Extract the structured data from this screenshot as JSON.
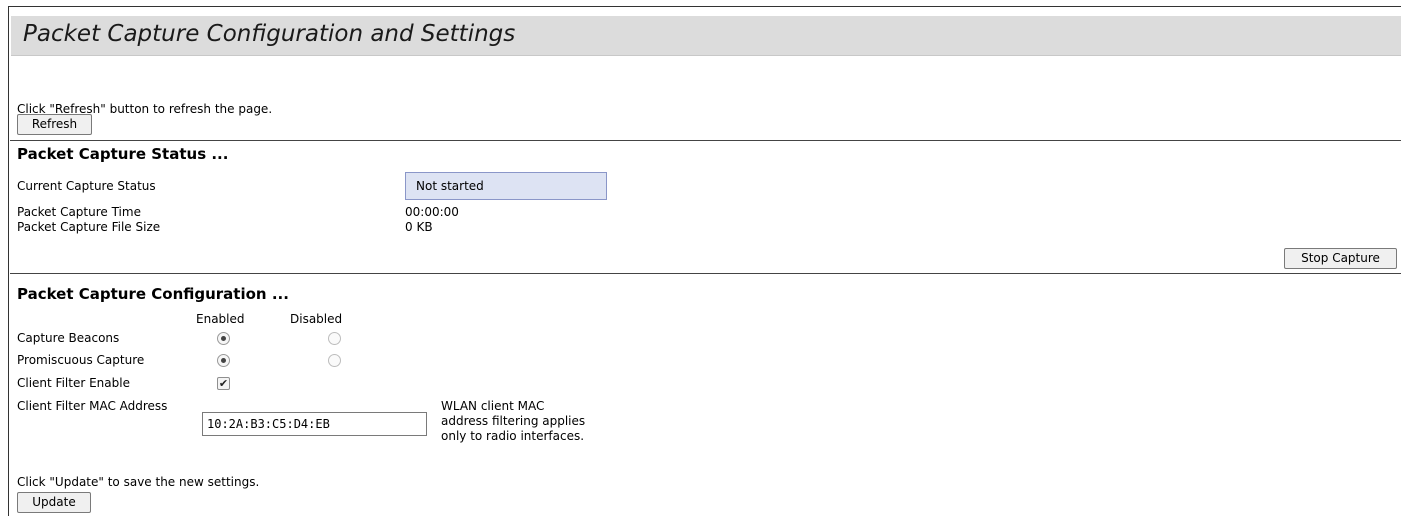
{
  "page": {
    "title": "Packet Capture Configuration and Settings"
  },
  "refresh": {
    "hint": "Click \"Refresh\" button to refresh the page.",
    "button_label": "Refresh"
  },
  "status": {
    "section_title": "Packet Capture Status ...",
    "rows": [
      {
        "label": "Current Capture Status",
        "value": "Not started"
      },
      {
        "label": "Packet Capture Time",
        "value": "00:00:00"
      },
      {
        "label": "Packet Capture File Size",
        "value": "0 KB"
      }
    ],
    "stop_button_label": "Stop Capture"
  },
  "config": {
    "section_title": "Packet Capture Configuration ...",
    "col_enabled": "Enabled",
    "col_disabled": "Disabled",
    "capture_beacons": {
      "label": "Capture Beacons",
      "selected": "enabled"
    },
    "promiscuous_capture": {
      "label": "Promiscuous Capture",
      "selected": "enabled"
    },
    "client_filter_enable": {
      "label": "Client Filter Enable",
      "checked": true
    },
    "client_filter_mac": {
      "label": "Client Filter MAC Address",
      "value": "10:2A:B3:C5:D4:EB",
      "note_lines": [
        "WLAN client MAC",
        "address filtering applies",
        "only to radio interfaces."
      ]
    }
  },
  "update": {
    "hint": "Click \"Update\" to save the new settings.",
    "button_label": "Update"
  },
  "icons": {
    "checkbox_check": "check-mark-icon",
    "radio_selected": "radio-dot-icon"
  },
  "colors": {
    "title_bar_bg": "#dcdcdc",
    "status_box_bg": "#dde3f3",
    "status_box_border": "#8a96c8"
  }
}
